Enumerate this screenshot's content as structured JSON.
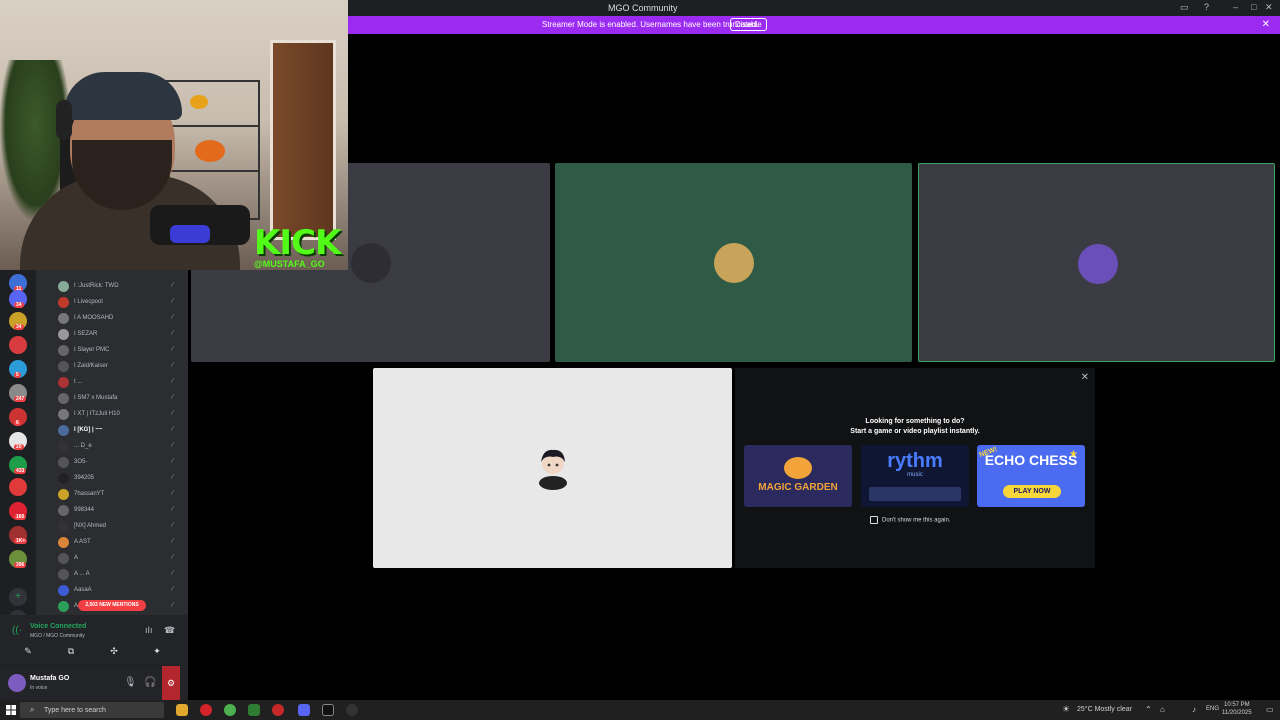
{
  "window": {
    "title": "MGO Community",
    "controls": [
      "▭",
      "?",
      "–",
      "□",
      "✕"
    ]
  },
  "banner": {
    "text": "Streamer Mode is enabled. Usernames have been truncated.",
    "button": "Disable",
    "close": "✕"
  },
  "webcam": {
    "overlay_brand": "KICK",
    "overlay_handle": "@MUSTAFA_GO"
  },
  "servers": [
    {
      "color": "#3d6fd6",
      "badge": "11"
    },
    {
      "color": "#5865f2",
      "badge": "34"
    },
    {
      "color": "#c9a227",
      "badge": "34"
    },
    {
      "color": "#d83c3e",
      "badge": ""
    },
    {
      "color": "#2b9cd8",
      "badge": "5"
    },
    {
      "color": "#8a8a8a",
      "badge": "247"
    },
    {
      "color": "#c33",
      "badge": "6"
    },
    {
      "color": "#e6e6e6",
      "badge": "20"
    },
    {
      "color": "#1e9e4a",
      "badge": "433"
    },
    {
      "color": "#e03a3a",
      "badge": ""
    },
    {
      "color": "#d23",
      "badge": "160"
    },
    {
      "color": "#a03030",
      "badge": "1K+"
    },
    {
      "color": "#6b8f3a",
      "badge": "396"
    }
  ],
  "members": [
    {
      "name": "I :JustRick: TWD",
      "color": "#8a9"
    },
    {
      "name": "I Livecpool",
      "color": "#c0392b"
    },
    {
      "name": "I A MOOSAHD",
      "color": "#777"
    },
    {
      "name": "I SEZAR",
      "color": "#999"
    },
    {
      "name": "I Slayer PMC",
      "color": "#666"
    },
    {
      "name": "I Zaid/Kaiser",
      "color": "#555"
    },
    {
      "name": "I ...",
      "color": "#a33"
    },
    {
      "name": "I SM7 x Mustafa",
      "color": "#666"
    },
    {
      "name": "I XT | ITzJuli H10",
      "color": "#777"
    },
    {
      "name": "I [KG] | ~~",
      "color": "#4a6b9c",
      "selected": true
    },
    {
      "name": "... D_e",
      "color": "#333"
    },
    {
      "name": "3O5-",
      "color": "#555"
    },
    {
      "name": "394205",
      "color": "#222"
    },
    {
      "name": "7hassanYT",
      "color": "#c9a227"
    },
    {
      "name": "998344",
      "color": "#666"
    },
    {
      "name": "[NX] Ahmed",
      "color": "#333"
    },
    {
      "name": "A AST",
      "color": "#d9843a"
    },
    {
      "name": "A",
      "color": "#555"
    },
    {
      "name": "A ... A",
      "color": "#555"
    },
    {
      "name": "AasaA",
      "color": "#3d5bd6"
    },
    {
      "name": "A",
      "color": "#2ca05a"
    }
  ],
  "mentions": "2,503 NEW MENTIONS",
  "voice": {
    "status": "Voice Connected",
    "channel": "MGO / MGO Community",
    "actions": [
      "✎",
      "⧉",
      "✣",
      "✦"
    ]
  },
  "user": {
    "name": "Mustafa GO",
    "status": "In voice"
  },
  "stage": {
    "tiles": [
      {
        "bg": "#3b3c43",
        "avatar": "#2d2d33"
      },
      {
        "bg": "#2f5a45",
        "avatar": "#c8a35a"
      },
      {
        "bg": "#3b3c43",
        "avatar": "#6a4fb8",
        "speaking": true
      }
    ],
    "spotlight_bg": "#e8e8e8"
  },
  "activity": {
    "close": "✕",
    "heading_1": "Looking for something to do?",
    "heading_2": "Start a game or video playlist instantly.",
    "games": [
      {
        "title": "MAGIC GARDEN",
        "bg": "#2a2a5e",
        "accent": "#f2a33a"
      },
      {
        "title": "rythm",
        "subtitle": "music",
        "bg": "#0e1633",
        "accent": "#4a7cff"
      },
      {
        "title": "ECHO CHESS",
        "tag": "NEW!",
        "cta": "PLAY NOW",
        "bg": "#4b6bf0",
        "accent": "#f7d63a"
      }
    ],
    "dont_show": "Don't show me this again."
  },
  "taskbar": {
    "search_placeholder": "Type here to search",
    "weather": "25°C  Mostly clear",
    "lang": "ENG",
    "time": "10:57 PM",
    "date": "11/20/2025"
  }
}
